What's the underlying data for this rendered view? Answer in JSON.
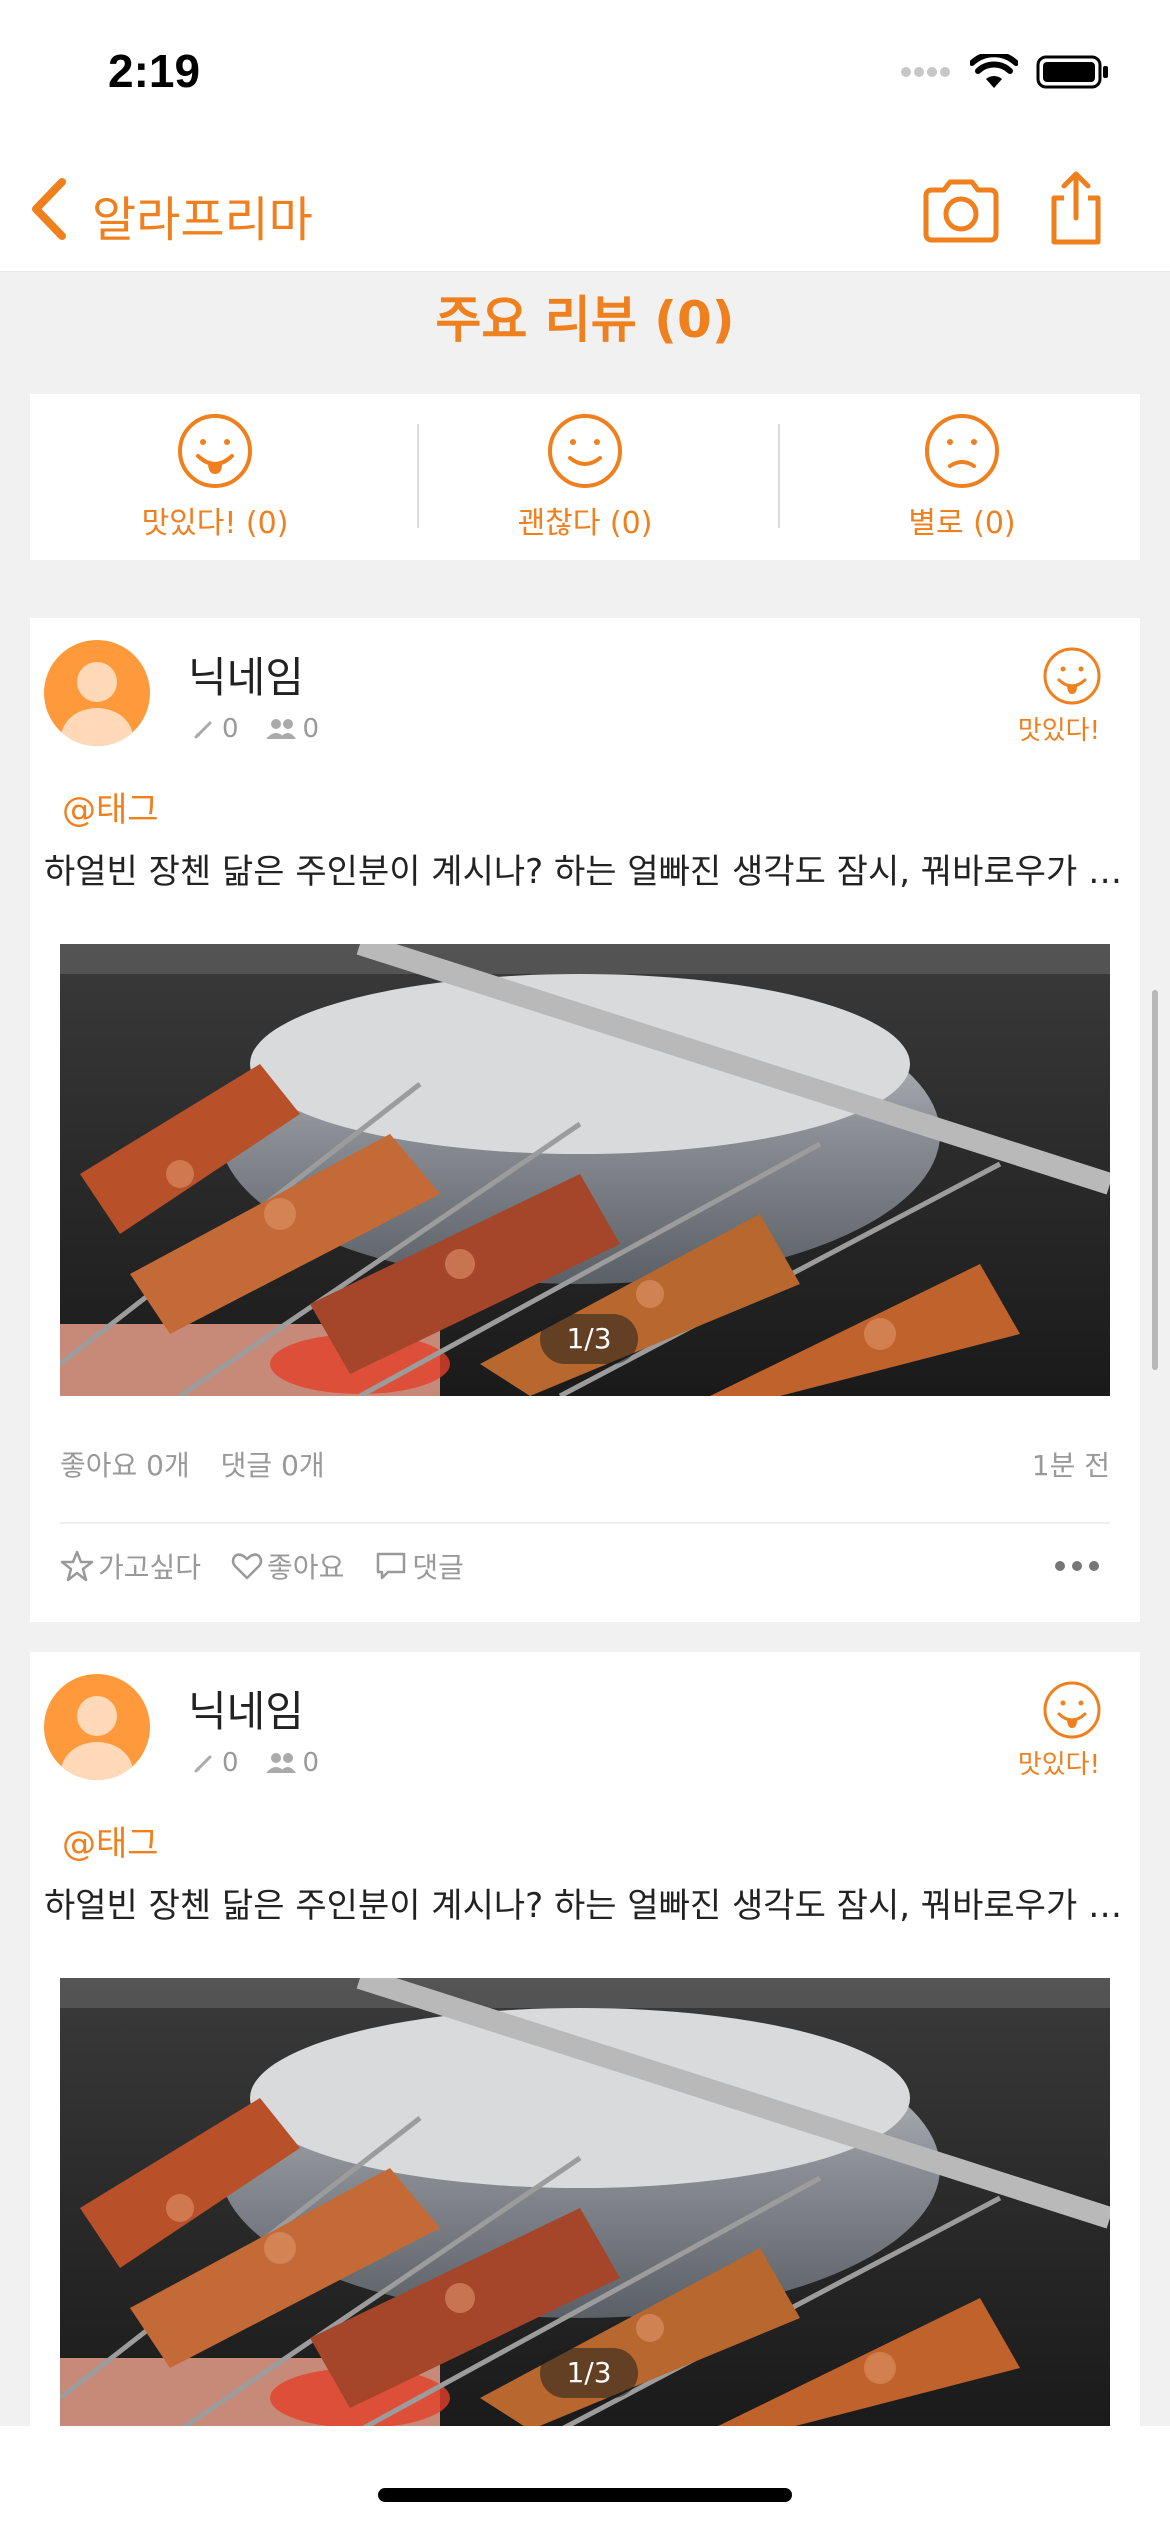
{
  "status": {
    "time": "2:19"
  },
  "nav": {
    "title": "알라프리마"
  },
  "summary": {
    "title": "주요 리뷰 (0)",
    "ratings": [
      {
        "label": "맛있다! (0)",
        "icon": "tongue-smile-face-icon"
      },
      {
        "label": "괜찮다 (0)",
        "icon": "smile-face-icon"
      },
      {
        "label": "별로 (0)",
        "icon": "frown-face-icon"
      }
    ]
  },
  "reviews": [
    {
      "nickname": "닉네임",
      "posts": "0",
      "followers": "0",
      "rating_label": "맛있다!",
      "tag": "@태그",
      "text": "하얼빈 장첸 닮은 주인분이 계시나? 하는 얼빠진 생각도 잠시, 꿔바로우가 나왔다",
      "photo_counter": "1/3",
      "likes": "좋아요 0개",
      "comments": "댓글 0개",
      "time": "1분 전",
      "actions": {
        "want": "가고싶다",
        "like": "좋아요",
        "comment": "댓글"
      }
    },
    {
      "nickname": "닉네임",
      "posts": "0",
      "followers": "0",
      "rating_label": "맛있다!",
      "tag": "@태그",
      "text": "하얼빈 장첸 닮은 주인분이 계시나? 하는 얼빠진 생각도 잠시, 꿔바로우가 나왔다",
      "photo_counter": "1/3"
    }
  ],
  "colors": {
    "accent": "#f07f1e",
    "background": "#f0f1f0",
    "muted": "#999999"
  }
}
